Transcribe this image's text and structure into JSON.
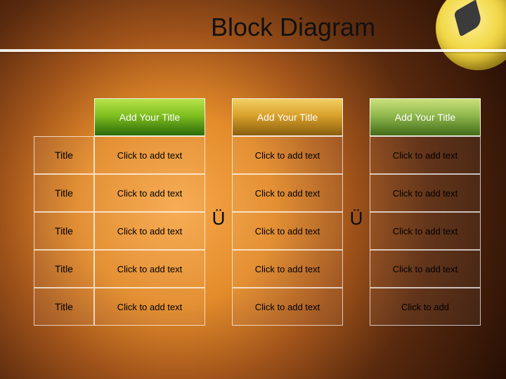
{
  "title": "Block Diagram",
  "arrow_glyph": "Ü",
  "row_labels": [
    "Title",
    "Title",
    "Title",
    "Title",
    "Title"
  ],
  "columns": [
    {
      "header": "Add Your Title",
      "cells": [
        "Click to add text",
        "Click to add text",
        "Click to add text",
        "Click to add text",
        "Click to add text"
      ]
    },
    {
      "header": "Add Your Title",
      "cells": [
        "Click to add text",
        "Click to add text",
        "Click to add text",
        "Click to add text",
        "Click to add text"
      ]
    },
    {
      "header": "Add Your Title",
      "cells": [
        "Click to add text",
        "Click to add text",
        "Click to add text",
        "Click to add text",
        "Click to add"
      ]
    }
  ]
}
